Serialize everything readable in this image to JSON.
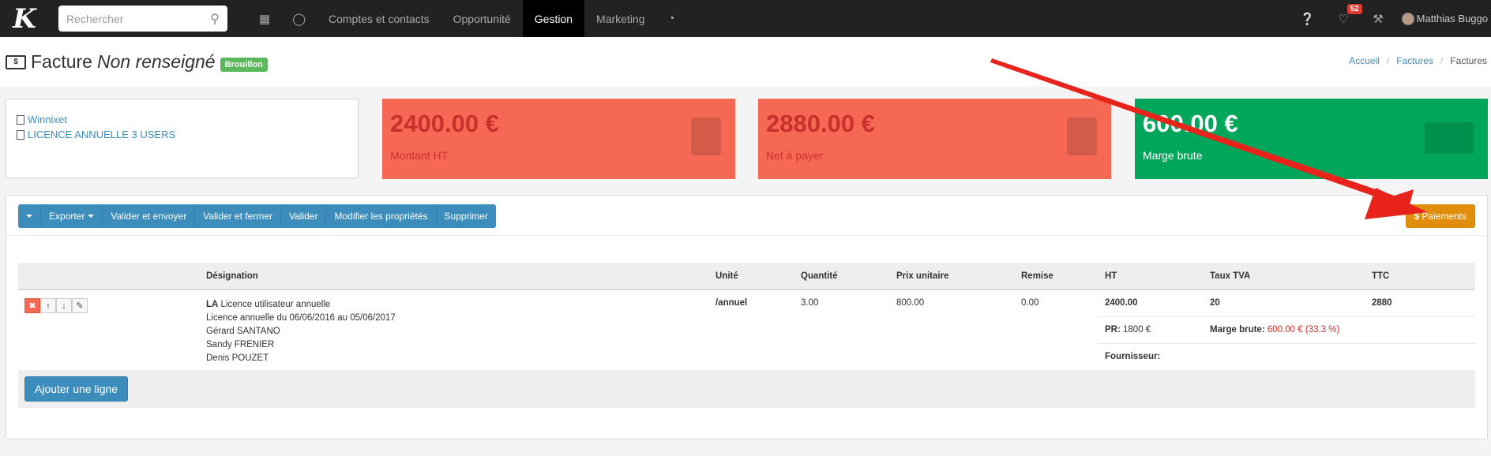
{
  "nav": {
    "logo": "K",
    "search_placeholder": "Rechercher",
    "items": [
      "Comptes et contacts",
      "Opportunité",
      "Gestion",
      "Marketing"
    ],
    "notifications": "52",
    "user": "Matthias Buggo"
  },
  "header": {
    "title": "Facture",
    "subtitle": "Non renseigné",
    "status": "Brouillon",
    "breadcrumb": [
      "Accueil",
      "Factures",
      "Factures"
    ]
  },
  "info": {
    "company": "Winnixet",
    "product": "LICENCE ANNUELLE 3 USERS"
  },
  "stats": [
    {
      "value": "2400.00 €",
      "label": "Montant HT",
      "color": "#f56954"
    },
    {
      "value": "2880.00 €",
      "label": "Net à payer",
      "color": "#f56954"
    },
    {
      "value": "600.00 €",
      "label": "Marge brute",
      "color": "#00a65a"
    }
  ],
  "toolbar": {
    "export": "Exporter",
    "validate_send": "Valider et envoyer",
    "validate_close": "Valider et fermer",
    "validate": "Valider",
    "edit": "Modifier les propriétés",
    "delete": "Supprimer",
    "payments": "Paiements"
  },
  "table": {
    "headers": [
      "Désignation",
      "Unité",
      "Quantité",
      "Prix unitaire",
      "Remise",
      "HT",
      "Taux TVA",
      "TTC"
    ],
    "row": {
      "code": "LA",
      "name": "Licence utilisateur annuelle",
      "lines": [
        "Licence annuelle du 06/06/2016 au 05/06/2017",
        "Gérard SANTANO",
        "Sandy FRENIER",
        "Denis POUZET"
      ],
      "unit": "/annuel",
      "quantity": "3.00",
      "unit_price": "800.00",
      "discount": "0.00",
      "ht": "2400.00",
      "vat": "20",
      "ttc": "2880",
      "pr_label": "PR:",
      "pr_value": "1800 €",
      "margin_label": "Marge brute:",
      "margin_value": "600.00 € (33.3 %)",
      "supplier_label": "Fournisseur:"
    },
    "add_line": "Ajouter une ligne"
  }
}
